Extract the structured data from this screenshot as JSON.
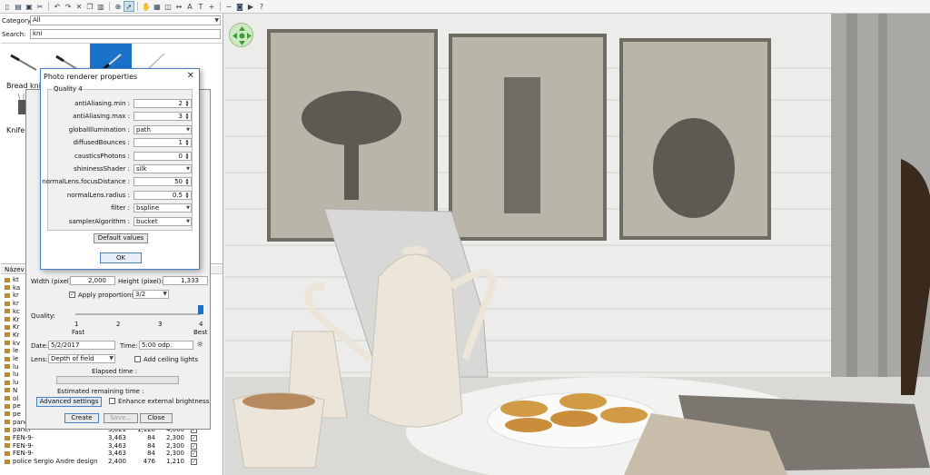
{
  "toolbar": {
    "icons": [
      "new-file-icon",
      "open-folder-icon",
      "save-icon",
      "cut-icon",
      "undo-icon",
      "redo-icon",
      "delete-icon",
      "copy-icon",
      "paste-icon",
      "add-furniture-icon",
      "select-icon",
      "pan-icon",
      "create-walls-icon",
      "create-rooms-icon",
      "create-dimensions-icon",
      "create-labels-icon",
      "text-icon",
      "zoom-in-icon",
      "zoom-out-icon",
      "photo-icon",
      "video-icon",
      "help-icon"
    ]
  },
  "left_panel": {
    "category_label": "Category:",
    "category_value": "All",
    "search_label": "Search:",
    "search_value": "kni",
    "catalog": [
      {
        "label": "Bread knife"
      },
      {
        "label": ""
      },
      {
        "label": ""
      },
      {
        "label": ""
      },
      {
        "label": "Knife s"
      }
    ],
    "furniture_header": "Název",
    "furniture_rows": [
      {
        "name": "kt",
        "w": "",
        "d": "",
        "h": "",
        "visible": false
      },
      {
        "name": "ka",
        "w": "",
        "d": "",
        "h": "",
        "visible": false
      },
      {
        "name": "kr",
        "w": "",
        "d": "",
        "h": "",
        "visible": false
      },
      {
        "name": "kr",
        "w": "",
        "d": "",
        "h": "",
        "visible": false
      },
      {
        "name": "kc",
        "w": "",
        "d": "",
        "h": "",
        "visible": false
      },
      {
        "name": "Kr",
        "w": "",
        "d": "",
        "h": "",
        "visible": false
      },
      {
        "name": "Kr",
        "w": "",
        "d": "",
        "h": "",
        "visible": false
      },
      {
        "name": "Kr",
        "w": "",
        "d": "",
        "h": "",
        "visible": false
      },
      {
        "name": "kv",
        "w": "",
        "d": "",
        "h": "",
        "visible": false
      },
      {
        "name": "le",
        "w": "",
        "d": "",
        "h": "",
        "visible": false
      },
      {
        "name": "le",
        "w": "",
        "d": "",
        "h": "",
        "visible": false
      },
      {
        "name": "lu",
        "w": "",
        "d": "",
        "h": "",
        "visible": false
      },
      {
        "name": "lu",
        "w": "",
        "d": "",
        "h": "",
        "visible": false
      },
      {
        "name": "lu",
        "w": "",
        "d": "",
        "h": "",
        "visible": false
      },
      {
        "name": "N",
        "w": "",
        "d": "",
        "h": "",
        "visible": false
      },
      {
        "name": "ol",
        "w": "",
        "d": "",
        "h": "",
        "visible": false
      },
      {
        "name": "pe",
        "w": "",
        "d": "",
        "h": "",
        "visible": false
      },
      {
        "name": "pe",
        "w": "",
        "d": "",
        "h": "",
        "visible": false
      },
      {
        "name": "panel",
        "w": "10,070",
        "d": "3,761",
        "h": "4,000",
        "visible": true
      },
      {
        "name": "panel",
        "w": "3,021",
        "d": "1,128",
        "h": "4,000",
        "visible": true
      },
      {
        "name": "FEN-9-",
        "w": "3,463",
        "d": "84",
        "h": "2,300",
        "visible": true
      },
      {
        "name": "FEN-9-",
        "w": "3,463",
        "d": "84",
        "h": "2,300",
        "visible": true
      },
      {
        "name": "FEN-9-",
        "w": "3,463",
        "d": "84",
        "h": "2,300",
        "visible": true
      },
      {
        "name": "police Sergio Andre design",
        "w": "2,400",
        "d": "476",
        "h": "1,210",
        "visible": true
      }
    ]
  },
  "photo_panel": {
    "width_label": "Width (pixel):",
    "width_value": "2,000",
    "height_label": "Height (pixel):",
    "height_value": "1,333",
    "apply_proportions_label": "Apply proportions:",
    "apply_proportions_checked": true,
    "proportion_value": "3/2",
    "quality_label": "Quality:",
    "quality_ticks": [
      "1",
      "2",
      "3",
      "4"
    ],
    "quality_fast": "Fast",
    "quality_best": "Best",
    "quality_level": 4,
    "date_label": "Date:",
    "date_value": "5/2/2017",
    "time_label": "Time:",
    "time_value": "5:00 odp.",
    "lens_label": "Lens:",
    "lens_value": "Depth of field",
    "ceiling_lights_label": "Add ceiling lights",
    "elapsed_label": "Elapsed time :",
    "remaining_label": "Estimated remaining time :",
    "advanced_button": "Advanced settings",
    "enhance_label": "Enhance external brightness",
    "create_button": "Create",
    "save_button": "Save...",
    "close_button": "Close"
  },
  "dialog": {
    "title": "Photo renderer properties",
    "group_label": "Quality 4",
    "properties": [
      {
        "label": "antiAliasing.min :",
        "value": "2",
        "kind": "spin"
      },
      {
        "label": "antiAliasing.max :",
        "value": "3",
        "kind": "spin"
      },
      {
        "label": "globalIllumination :",
        "value": "path",
        "kind": "combo"
      },
      {
        "label": "diffusedBounces :",
        "value": "1",
        "kind": "spin"
      },
      {
        "label": "causticsPhotons :",
        "value": "0",
        "kind": "spin"
      },
      {
        "label": "shininessShader :",
        "value": "silk",
        "kind": "combo"
      },
      {
        "label": "normalLens.focusDistance :",
        "value": "50",
        "kind": "spin"
      },
      {
        "label": "normalLens.radius :",
        "value": "0.5",
        "kind": "spin"
      },
      {
        "label": "filter :",
        "value": "bspline",
        "kind": "combo"
      },
      {
        "label": "samplerAlgorithm :",
        "value": "bucket",
        "kind": "combo"
      }
    ],
    "default_button": "Default values",
    "ok_button": "OK"
  },
  "accent_color": "#1a73c9"
}
